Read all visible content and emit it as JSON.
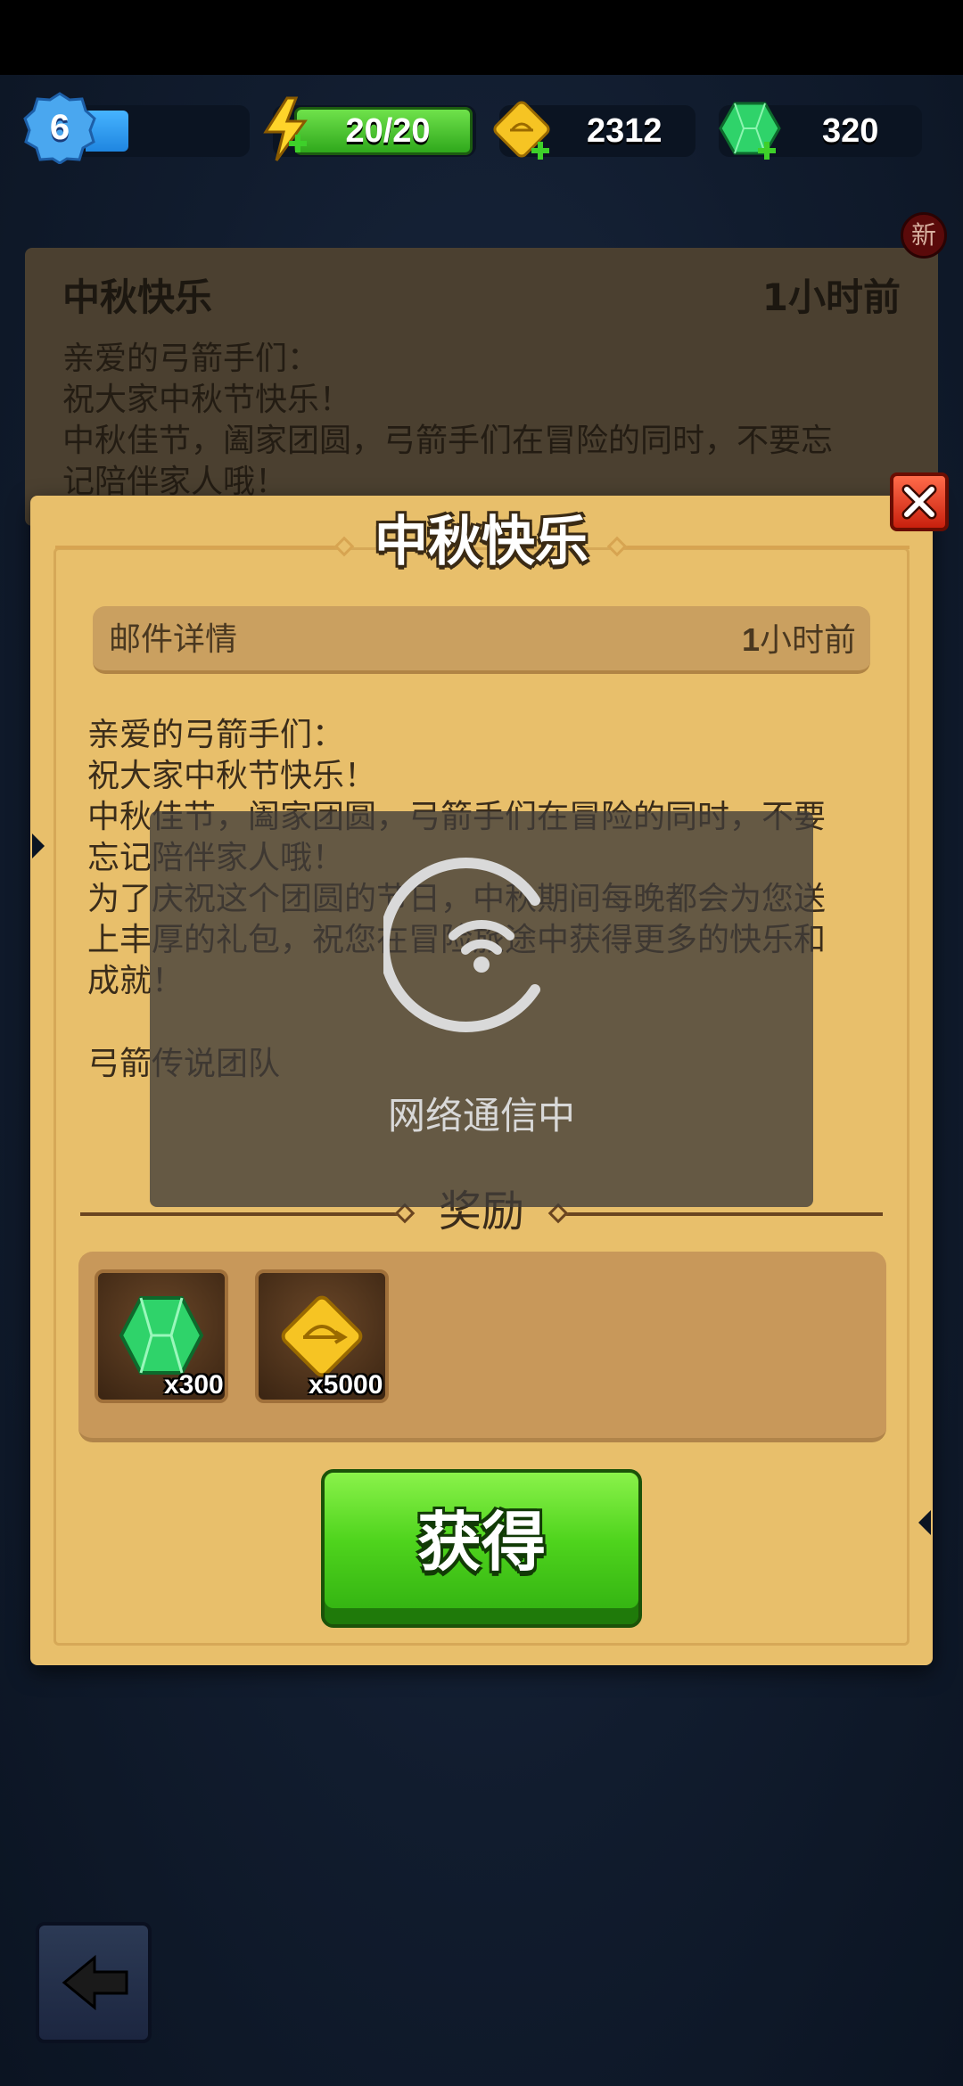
{
  "resources": {
    "level": "6",
    "energy": "20/20",
    "gold": "2312",
    "gems": "320"
  },
  "mail_list_item": {
    "title": "中秋快乐",
    "time": "1小时前",
    "badge": "新",
    "body": "亲爱的弓箭手们：\n祝大家中秋节快乐！\n中秋佳节，阖家团圆，弓箭手们在冒险的同时，不要忘\n记陪伴家人哦！"
  },
  "modal": {
    "title": "中秋快乐",
    "detail_label": "邮件详情",
    "time_num": "1",
    "time_unit": "小时前",
    "body": "亲爱的弓箭手们：\n祝大家中秋节快乐！\n中秋佳节，阖家团圆，弓箭手们在冒险的同时，不要\n忘记陪伴家人哦！\n为了庆祝这个团圆的节日，中秋期间每晚都会为您送\n上丰厚的礼包，祝您在冒险旅途中获得更多的快乐和\n成就！",
    "signature": "弓箭传说团队",
    "rewards_title": "奖励",
    "rewards": [
      {
        "icon": "gem-icon",
        "qty": "x300"
      },
      {
        "icon": "gold-coin-icon",
        "qty": "x5000"
      }
    ],
    "claim_label": "获得"
  },
  "loading": {
    "text": "网络通信中"
  },
  "colors": {
    "panel": "#e8bf6b",
    "claim_green": "#4fd41d",
    "close_red": "#c8200d",
    "gem_green": "#2fd36a",
    "gold": "#f6c423"
  }
}
